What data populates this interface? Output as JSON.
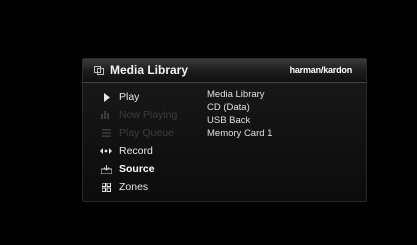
{
  "header": {
    "title": "Media Library",
    "brand": "harman/kardon"
  },
  "menu": {
    "items": [
      {
        "label": "Play",
        "icon": "play-icon",
        "state": "enabled"
      },
      {
        "label": "Now Playing",
        "icon": "equalizer-bars-icon",
        "state": "disabled"
      },
      {
        "label": "Play Queue",
        "icon": "list-icon",
        "state": "disabled"
      },
      {
        "label": "Record",
        "icon": "record-dots-icon",
        "state": "enabled"
      },
      {
        "label": "Source",
        "icon": "source-icon",
        "state": "selected"
      },
      {
        "label": "Zones",
        "icon": "zones-grid-icon",
        "state": "enabled"
      }
    ]
  },
  "sources": {
    "items": [
      {
        "label": "Media Library"
      },
      {
        "label": "CD (Data)"
      },
      {
        "label": "USB Back"
      },
      {
        "label": "Memory Card 1"
      }
    ]
  },
  "colors": {
    "background": "#000000",
    "text": "#e6e6e6",
    "disabled": "#3c3c3c"
  }
}
